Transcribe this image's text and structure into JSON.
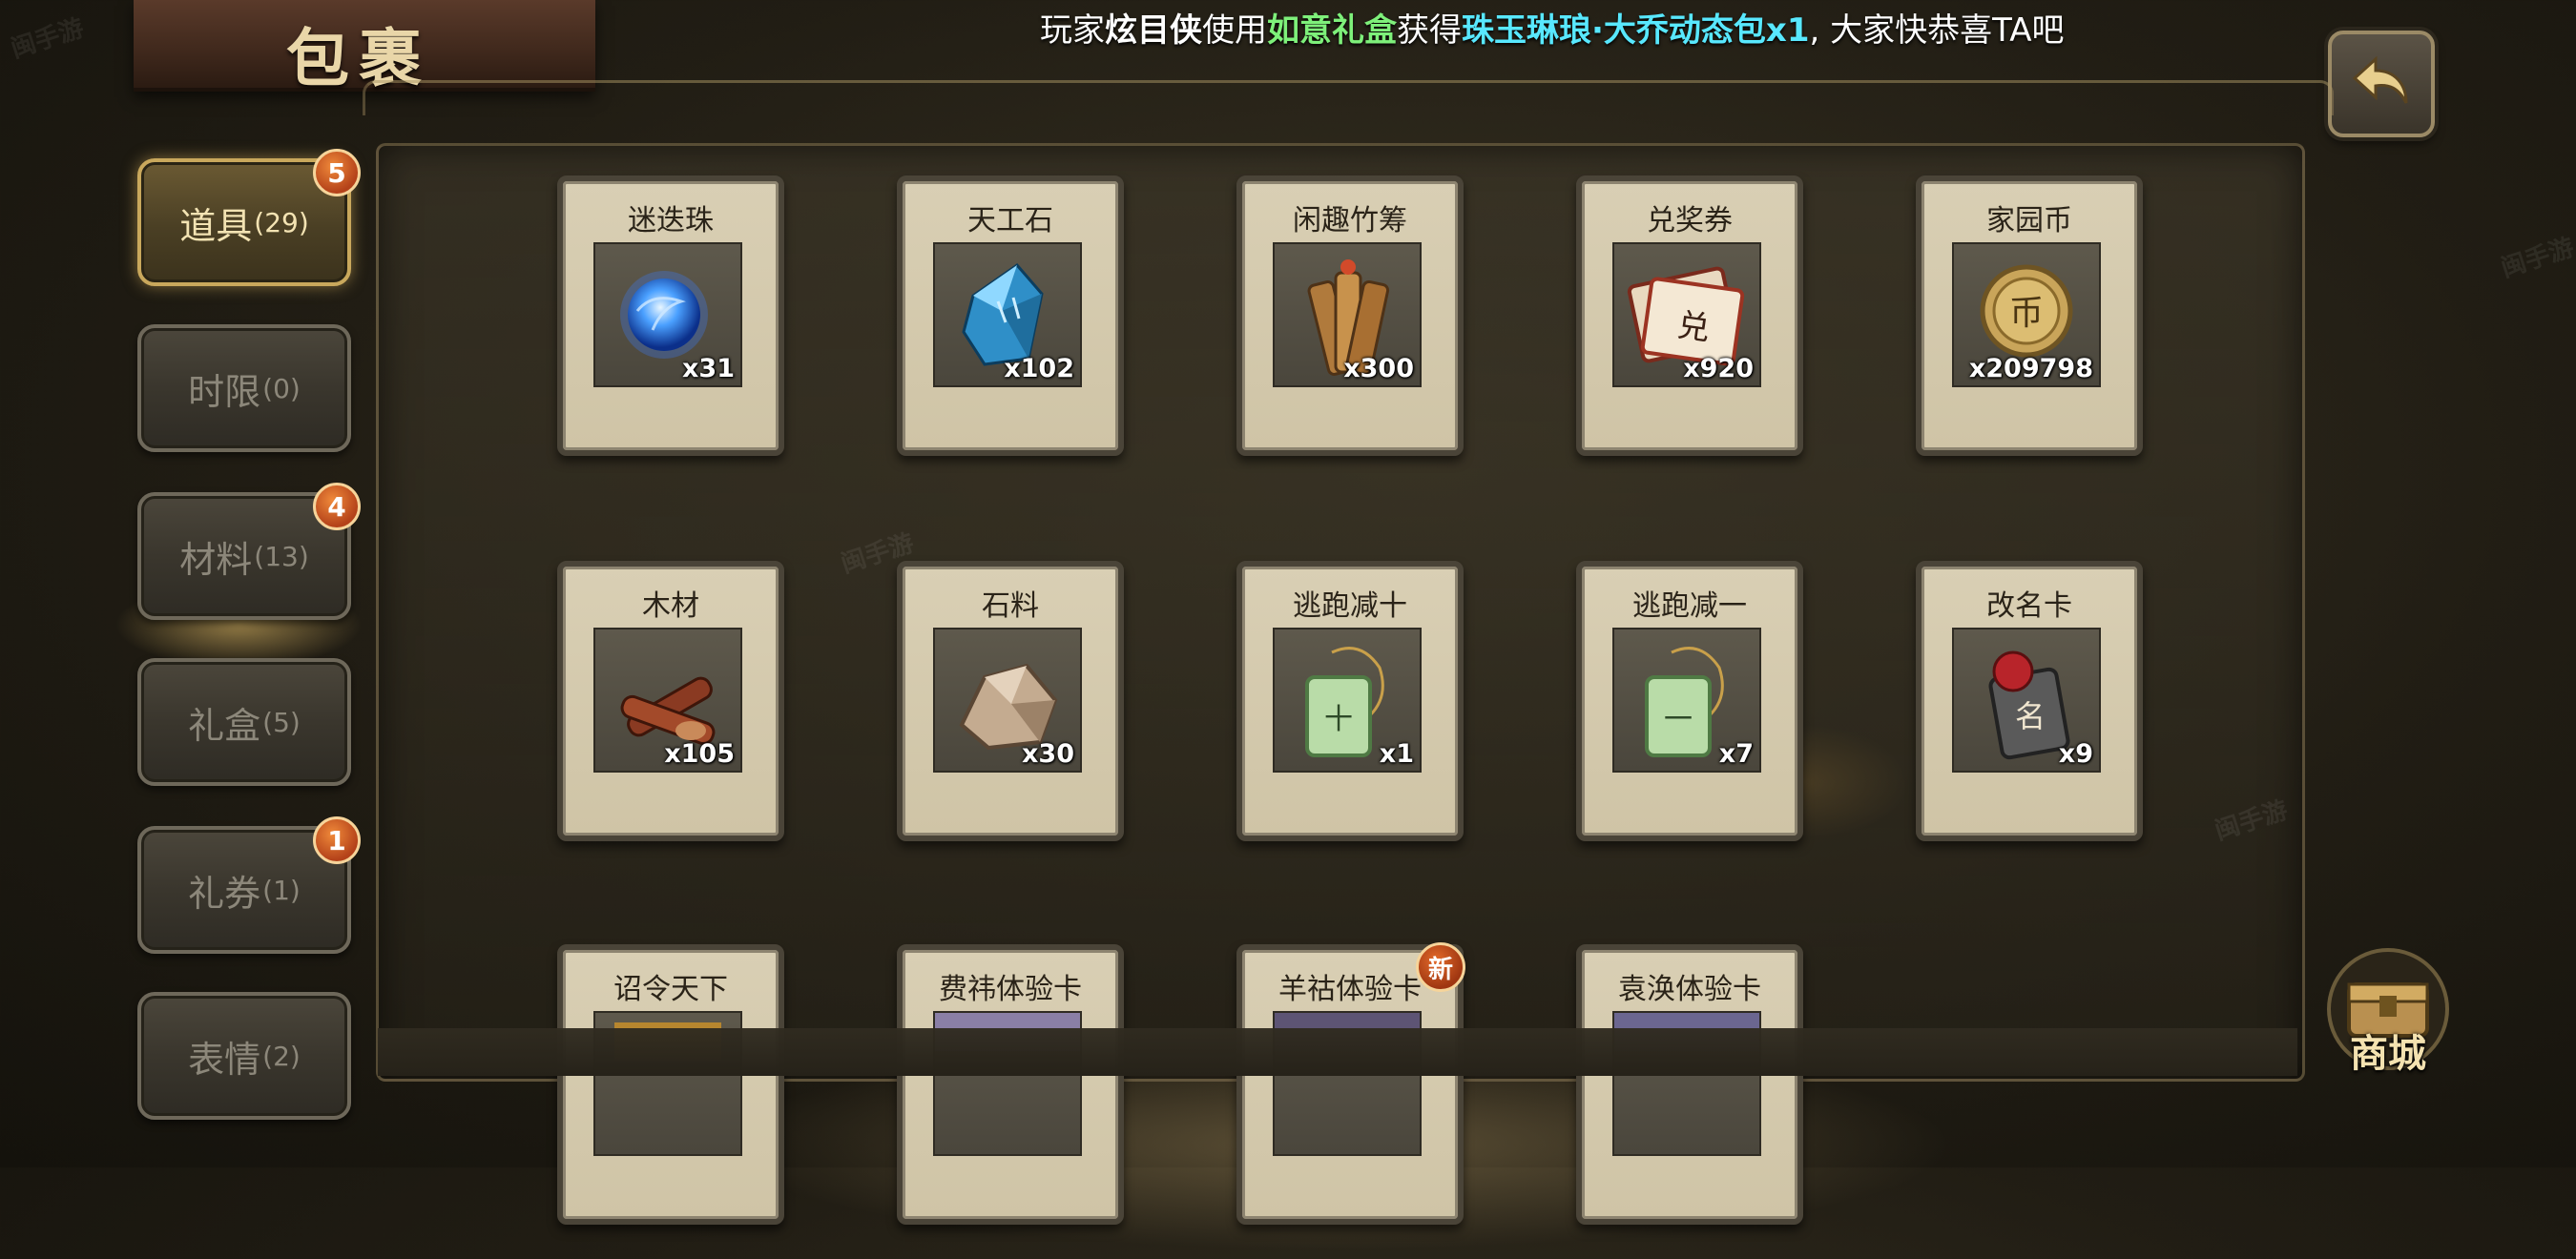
{
  "title": "包裹",
  "ticker": {
    "prefix": "玩家",
    "player": "炫目侠",
    "used": "使用",
    "gift": "如意礼盒",
    "got": "获得",
    "item": "珠玉琳琅·大乔动态包x1",
    "suffix": ", 大家快恭喜TA吧"
  },
  "sidebar": {
    "tabs": [
      {
        "label": "道具",
        "count": "(29)",
        "badge": "5",
        "active": true
      },
      {
        "label": "时限",
        "count": "(0)",
        "badge": "",
        "active": false
      },
      {
        "label": "材料",
        "count": "(13)",
        "badge": "4",
        "active": false
      },
      {
        "label": "礼盒",
        "count": "(5)",
        "badge": "",
        "active": false
      },
      {
        "label": "礼券",
        "count": "(1)",
        "badge": "1",
        "active": false
      },
      {
        "label": "表情",
        "count": "(2)",
        "badge": "",
        "active": false
      }
    ]
  },
  "items": [
    {
      "name": "迷迭珠",
      "qty": "x31",
      "icon": "blue-orb-icon"
    },
    {
      "name": "天工石",
      "qty": "x102",
      "icon": "blue-crystal-icon"
    },
    {
      "name": "闲趣竹筹",
      "qty": "x300",
      "icon": "bamboo-tokens-icon"
    },
    {
      "name": "兑奖券",
      "qty": "x920",
      "icon": "exchange-ticket-icon"
    },
    {
      "name": "家园币",
      "qty": "x209798",
      "icon": "home-coin-icon"
    },
    {
      "name": "木材",
      "qty": "x105",
      "icon": "wood-icon"
    },
    {
      "name": "石料",
      "qty": "x30",
      "icon": "stone-icon"
    },
    {
      "name": "逃跑减十",
      "qty": "x1",
      "icon": "jade-tag-ten-icon"
    },
    {
      "name": "逃跑减一",
      "qty": "x7",
      "icon": "jade-tag-one-icon"
    },
    {
      "name": "改名卡",
      "qty": "x9",
      "icon": "rename-card-icon"
    },
    {
      "name": "诏令天下",
      "qty": "",
      "icon": "edict-icon"
    },
    {
      "name": "费祎体验卡",
      "qty": "",
      "icon": "hero-trial-card-icon"
    },
    {
      "name": "羊祜体验卡",
      "qty": "",
      "icon": "hero-trial-card-icon",
      "badge": "新"
    },
    {
      "name": "袁涣体验卡",
      "qty": "",
      "icon": "hero-trial-card-icon"
    }
  ],
  "shop": {
    "label": "商城"
  },
  "colors": {
    "accent_gold": "#c9a85c",
    "badge_orange": "#d9622a",
    "card_bg": "#d6ccb0"
  }
}
